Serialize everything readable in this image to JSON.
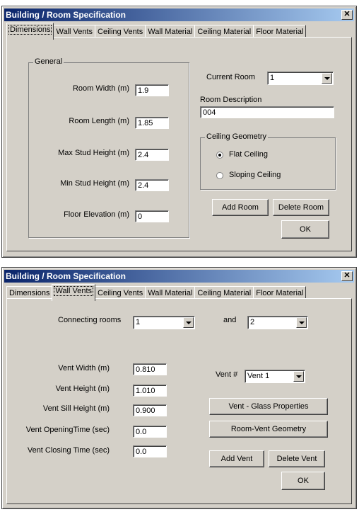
{
  "dialog1": {
    "title": "Building / Room Specification",
    "close": "✕",
    "tabs": [
      "Dimensions",
      "Wall Vents",
      "Ceiling Vents",
      "Wall Material",
      "Ceiling Material",
      "Floor Material"
    ],
    "active_tab": "Dimensions",
    "general": {
      "legend": "General",
      "fields": [
        {
          "label": "Room Width (m)",
          "value": "1.9"
        },
        {
          "label": "Room Length (m)",
          "value": "1.85"
        },
        {
          "label": "Max Stud Height (m)",
          "value": "2.4"
        },
        {
          "label": "Min Stud Height (m)",
          "value": "2.4"
        },
        {
          "label": "Floor Elevation (m)",
          "value": "0"
        }
      ]
    },
    "current_room_label": "Current Room",
    "current_room_value": "1",
    "room_description_label": "Room Description",
    "room_description_value": "004",
    "ceiling_geometry": {
      "legend": "Ceiling Geometry",
      "flat": "Flat Ceiling",
      "sloping": "Sloping Ceiling",
      "selected": "flat"
    },
    "add_room": "Add Room",
    "delete_room": "Delete Room",
    "ok": "OK"
  },
  "dialog2": {
    "title": "Building / Room Specification",
    "close": "✕",
    "tabs": [
      "Dimensions",
      "Wall Vents",
      "Ceiling Vents",
      "Wall Material",
      "Ceiling Material",
      "Floor Material"
    ],
    "active_tab": "Wall Vents",
    "connecting_rooms_label": "Connecting rooms",
    "room_a": "1",
    "and_label": "and",
    "room_b": "2",
    "fields": [
      {
        "label": "Vent Width (m)",
        "value": "0.810"
      },
      {
        "label": "Vent Height (m)",
        "value": "1.010"
      },
      {
        "label": "Vent Sill Height (m)",
        "value": "0.900"
      },
      {
        "label": "Vent OpeningTime (sec)",
        "value": "0.0"
      },
      {
        "label": "Vent Closing Time (sec)",
        "value": "0.0"
      }
    ],
    "vent_num_label": "Vent #",
    "vent_num_value": "Vent 1",
    "glass_properties": "Vent - Glass Properties",
    "room_vent_geometry": "Room-Vent Geometry",
    "add_vent": "Add Vent",
    "delete_vent": "Delete Vent",
    "ok": "OK"
  }
}
